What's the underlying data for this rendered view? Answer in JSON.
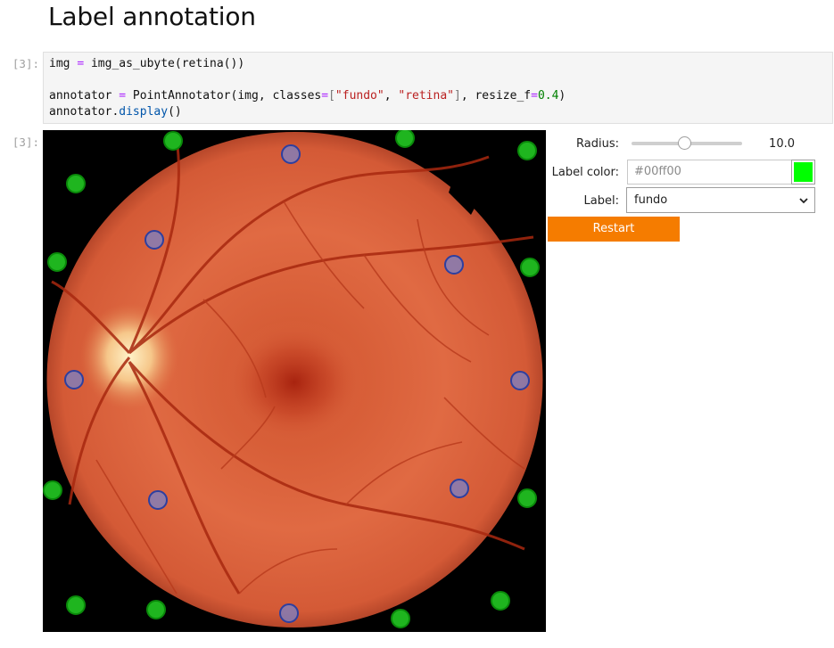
{
  "notebook": {
    "heading": "Label annotation"
  },
  "code_cell": {
    "prompt": "[3]:",
    "lines": {
      "l1": {
        "a": "img ",
        "op": "=",
        "b": " img_as_ubyte(retina())"
      },
      "l3": {
        "a": "annotator ",
        "op": "=",
        " b": "",
        "b": " PointAnnotator(img, classes",
        "op2": "=",
        "p1": "[",
        "s1": "\"fundo\"",
        "c1": ", ",
        "s2": "\"retina\"",
        "p2": "]",
        "c2": ", resize_f",
        "op3": "=",
        "n1": "0.4",
        "end": ")"
      },
      "l4": {
        "a": "annotator.",
        "attr": "display",
        "b": "()"
      }
    }
  },
  "output_cell": {
    "prompt": "[3]:",
    "image": "retina fundus image",
    "points": {
      "fundo_color": "#00ff00",
      "retina_color": "#6a7fd0",
      "fundo_count": 14,
      "retina_count": 10
    }
  },
  "controls": {
    "radius_label": "Radius:",
    "radius_value": "10.0",
    "radius_fraction": 0.48,
    "label_color_label": "Label color:",
    "label_color_placeholder": "#00ff00",
    "label_color_value": "#00ff00",
    "label_label": "Label:",
    "label_selected": "fundo",
    "restart_label": "Restart",
    "restart_color": "#f57c00"
  }
}
